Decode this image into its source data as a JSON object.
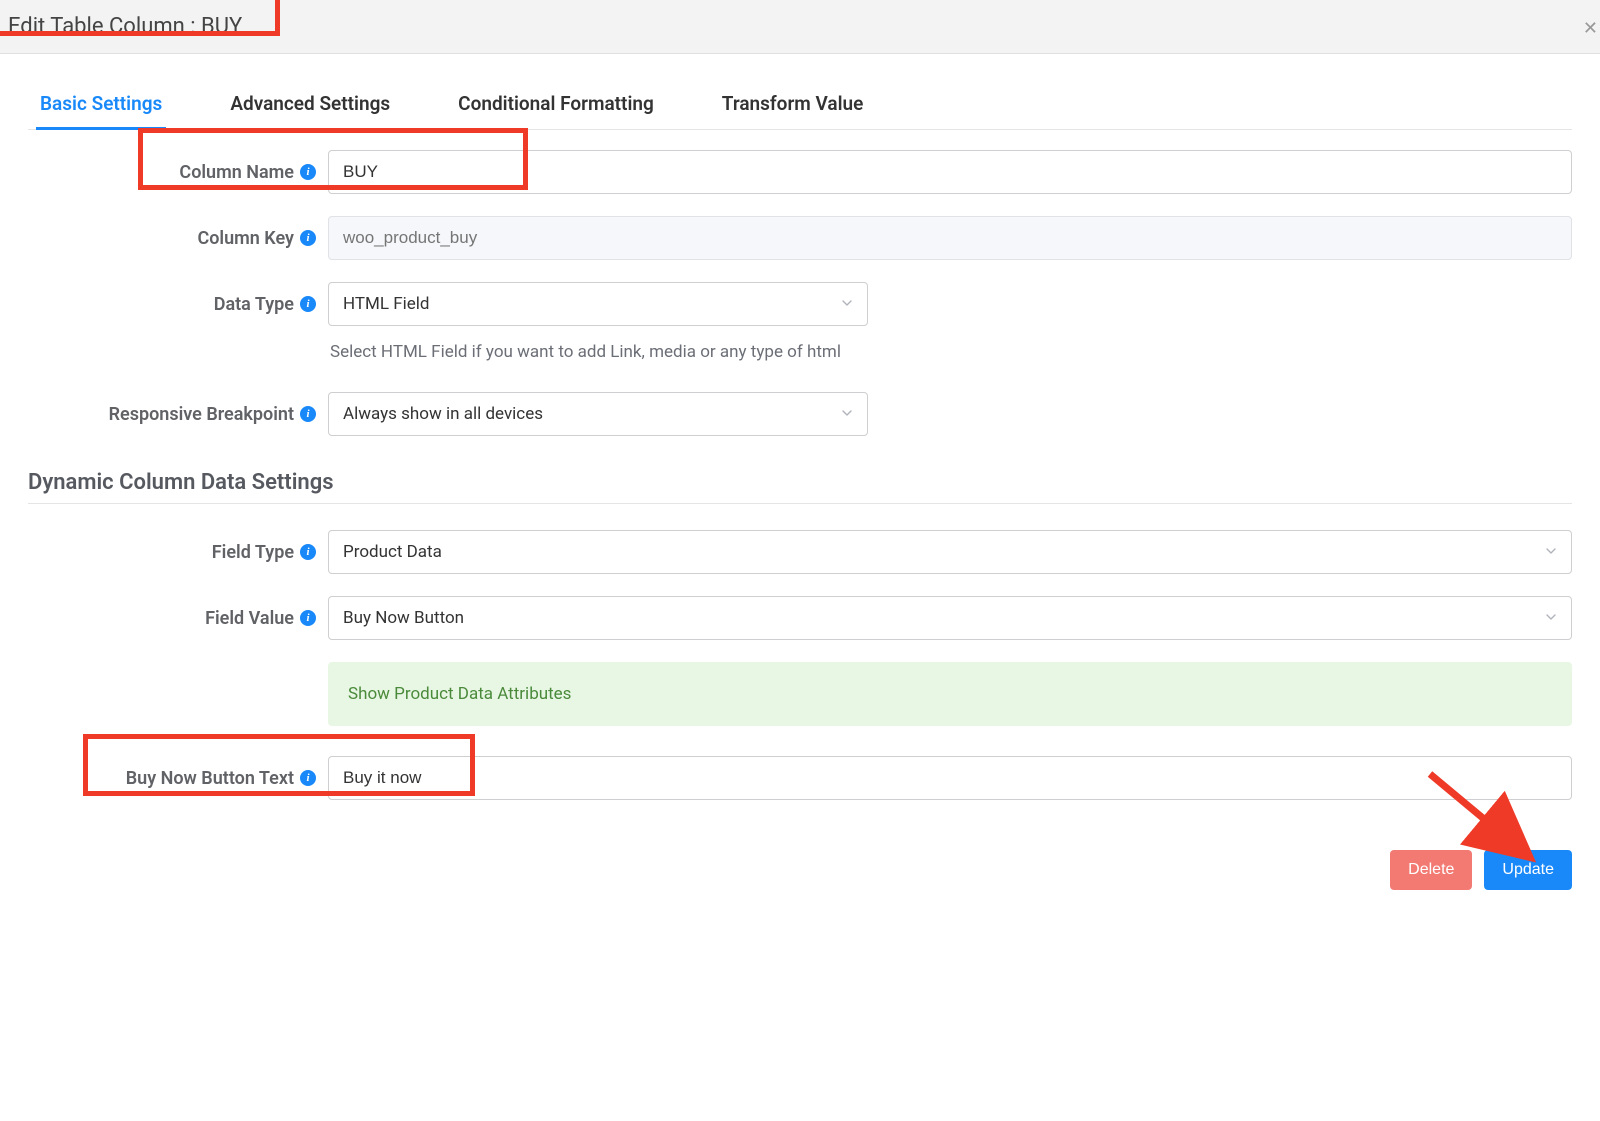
{
  "header": {
    "title": "Edit Table Column : BUY"
  },
  "tabs": {
    "basic": "Basic Settings",
    "advanced": "Advanced Settings",
    "conditional": "Conditional Formatting",
    "transform": "Transform Value"
  },
  "fields": {
    "column_name": {
      "label": "Column Name",
      "value": "BUY"
    },
    "column_key": {
      "label": "Column Key",
      "placeholder": "woo_product_buy"
    },
    "data_type": {
      "label": "Data Type",
      "value": "HTML Field",
      "help": "Select HTML Field if you want to add Link, media or any type of html"
    },
    "responsive": {
      "label": "Responsive Breakpoint",
      "value": "Always show in all devices"
    }
  },
  "dynamic": {
    "heading": "Dynamic Column Data Settings",
    "field_type": {
      "label": "Field Type",
      "value": "Product Data"
    },
    "field_value": {
      "label": "Field Value",
      "value": "Buy Now Button"
    },
    "banner": "Show Product Data Attributes",
    "buy_now_text": {
      "label": "Buy Now Button Text",
      "value": "Buy it now"
    }
  },
  "footer": {
    "delete": "Delete",
    "update": "Update"
  }
}
